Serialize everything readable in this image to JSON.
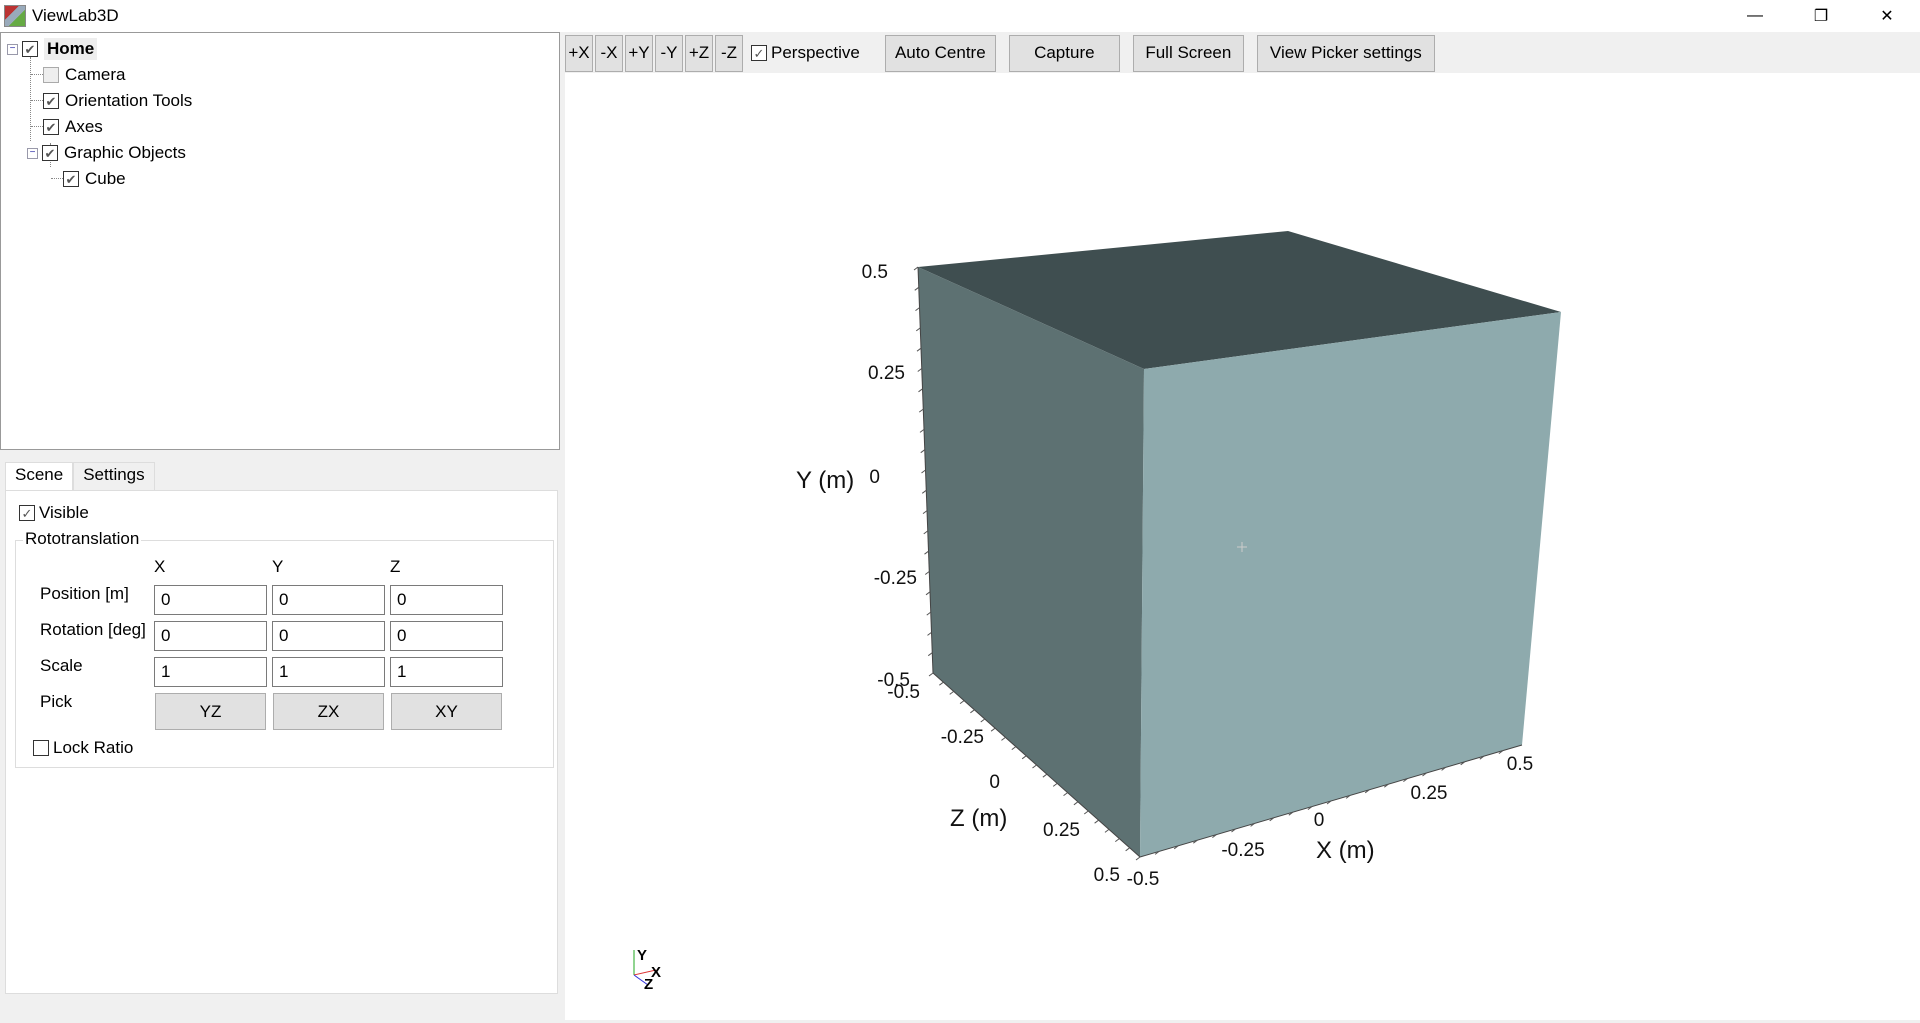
{
  "window": {
    "title": "ViewLab3D",
    "minimize": "—",
    "restore": "❐",
    "close": "✕"
  },
  "tree": {
    "items": [
      {
        "label": "Home",
        "checked": true
      },
      {
        "label": "Camera",
        "checked": false
      },
      {
        "label": "Orientation Tools",
        "checked": true
      },
      {
        "label": "Axes",
        "checked": true
      },
      {
        "label": "Graphic Objects",
        "checked": true
      },
      {
        "label": "Cube",
        "checked": true
      }
    ]
  },
  "tabs": {
    "scene": "Scene",
    "settings": "Settings"
  },
  "scene": {
    "visible_label": "Visible",
    "group_title": "Rototranslation",
    "col_x": "X",
    "col_y": "Y",
    "col_z": "Z",
    "position_label": "Position [m]",
    "position": [
      "0",
      "0",
      "0"
    ],
    "rotation_label": "Rotation [deg]",
    "rotation": [
      "0",
      "0",
      "0"
    ],
    "scale_label": "Scale",
    "scale": [
      "1",
      "1",
      "1"
    ],
    "pick_label": "Pick",
    "pick": [
      "YZ",
      "ZX",
      "XY"
    ],
    "lock_ratio_label": "Lock Ratio"
  },
  "toolbar": {
    "axis_buttons": [
      "+X",
      "-X",
      "+Y",
      "-Y",
      "+Z",
      "-Z"
    ],
    "perspective_label": "Perspective",
    "perspective": true,
    "auto_centre": "Auto Centre",
    "capture": "Capture",
    "full_screen": "Full Screen",
    "view_picker": "View Picker settings"
  },
  "viewport": {
    "colors": {
      "top": "#3f4e50",
      "left": "#5d7172",
      "front": "#8eaaad"
    },
    "y_axis": {
      "label": "Y (m)",
      "ticks": [
        "0.5",
        "0.25",
        "0",
        "-0.25",
        "-0.5"
      ]
    },
    "z_axis": {
      "label": "Z (m)",
      "ticks": [
        "-0.5",
        "-0.25",
        "0",
        "0.25",
        "0.5"
      ]
    },
    "x_axis": {
      "label": "X (m)",
      "ticks": [
        "-0.5",
        "-0.25",
        "0",
        "0.25",
        "0.5"
      ]
    },
    "triad": {
      "x": "X",
      "y": "Y",
      "z": "Z"
    }
  }
}
